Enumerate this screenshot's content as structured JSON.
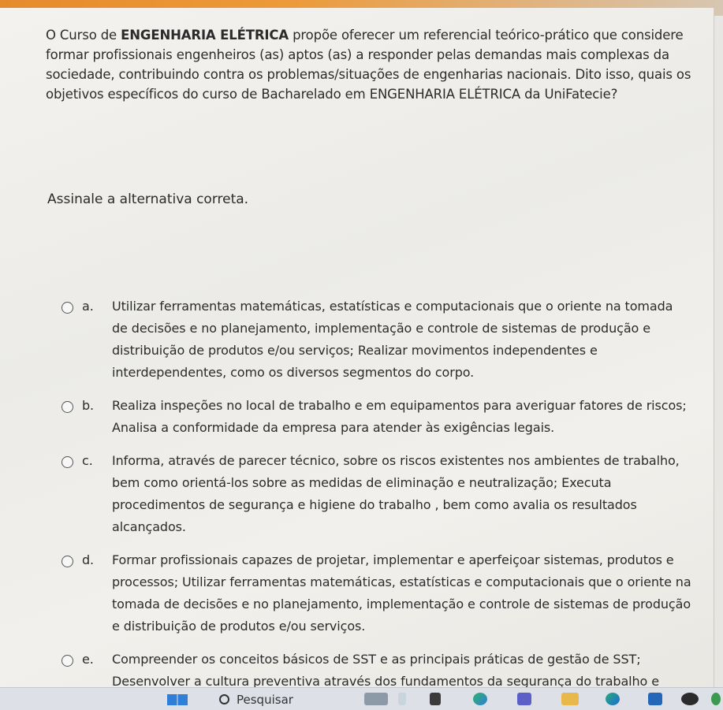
{
  "question": {
    "prefix": "O Curso de ",
    "course_bold": "ENGENHARIA ELÉTRICA",
    "suffix": " propõe oferecer um referencial teórico-prático que considere formar profissionais engenheiros (as) aptos (as) a responder pelas demandas mais complexas da sociedade, contribuindo contra os problemas/situações de engenharias nacionais. Dito isso, quais os objetivos específicos do curso de Bacharelado em ENGENHARIA ELÉTRICA da UniFatecie?"
  },
  "instruction": "Assinale a alternativa correta.",
  "options": [
    {
      "letter": "a.",
      "text": "Utilizar ferramentas matemáticas, estatísticas e computacionais que o oriente na tomada de decisões e no planejamento, implementação e controle de sistemas de produção e distribuição de produtos e/ou serviços; Realizar movimentos independentes e interdependentes, como os diversos segmentos do corpo."
    },
    {
      "letter": "b.",
      "text": "Realiza inspeções no local de trabalho e em equipamentos para averiguar fatores de riscos; Analisa a conformidade da empresa para atender às exigências legais."
    },
    {
      "letter": "c.",
      "text": "Informa, através de parecer técnico, sobre os riscos existentes nos ambientes de trabalho, bem como orientá-los sobre as medidas de eliminação e neutralização; Executa procedimentos de segurança e higiene do trabalho , bem como avalia os resultados alcançados."
    },
    {
      "letter": "d.",
      "text": "Formar profissionais capazes de projetar, implementar e aperfeiçoar sistemas, produtos e processos; Utilizar ferramentas matemáticas, estatísticas e computacionais que o oriente na tomada de decisões e no planejamento, implementação e controle de sistemas de produção e distribuição de produtos e/ou serviços."
    },
    {
      "letter": "e.",
      "text": "Compreender os conceitos básicos de SST e as principais práticas de gestão de SST; Desenvolver a cultura preventiva através dos fundamentos da segurança do trabalho e"
    }
  ],
  "taskbar": {
    "search_label": "Pesquisar",
    "icons": [
      "windows-icon",
      "search-icon",
      "widgets-icon",
      "file-icon",
      "chat-icon",
      "copilot-icon",
      "teams-icon",
      "folder-icon",
      "edge-icon",
      "store-icon",
      "dell-icon",
      "chrome-icon"
    ]
  },
  "colors": {
    "accent": "#e68a2e",
    "taskbar": "#dde0e6",
    "windows": "#2f7fd8"
  }
}
